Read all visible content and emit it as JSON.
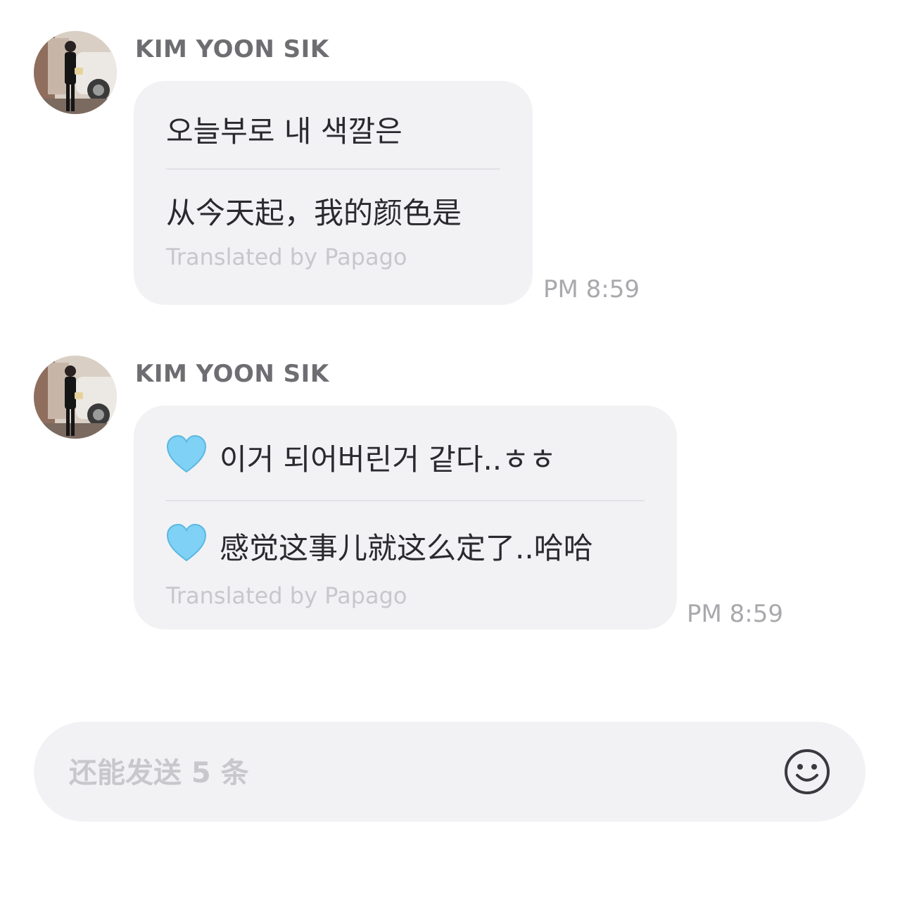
{
  "messages": [
    {
      "sender": "KIM YOON SIK",
      "original": "오늘부로 내 색깔은",
      "translation": "从今天起，我的颜色是",
      "credit": "Translated by Papago",
      "time": "PM 8:59"
    },
    {
      "sender": "KIM YOON SIK",
      "original": "이거 되어버린거 같다..ㅎㅎ",
      "translation": "感觉这事儿就这么定了..哈哈",
      "credit": "Translated by Papago",
      "time": "PM 8:59",
      "emoji": "light-blue-heart-icon"
    }
  ],
  "composer": {
    "placeholder": "还能发送 5 条",
    "emoji_button": "smiley-icon"
  },
  "colors": {
    "bubble": "#f2f2f5",
    "heart": "#7fd1f5",
    "muted_text": "#c7c7cc",
    "timestamp": "#a9a9ad"
  }
}
